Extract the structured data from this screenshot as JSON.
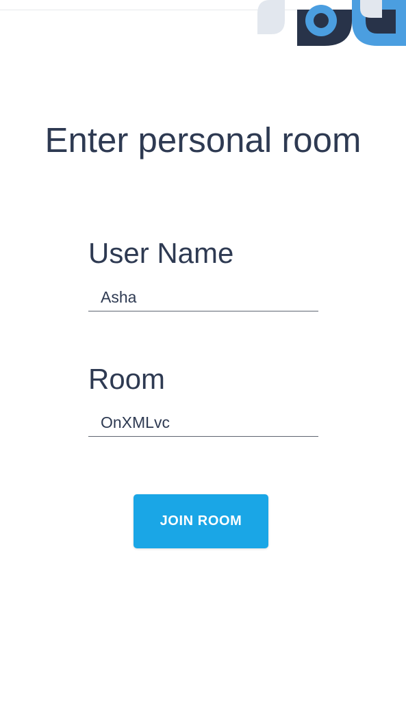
{
  "form": {
    "title": "Enter personal room",
    "user_name_label": "User Name",
    "user_name_value": "Asha",
    "room_label": "Room",
    "room_value": "OnXMLvc",
    "join_button_label": "JOIN ROOM"
  },
  "colors": {
    "text": "#2e3a52",
    "button_bg": "#1aa6e6",
    "logo_dark": "#283349",
    "logo_blue": "#4b9ee0",
    "logo_light": "#e2e7ee"
  },
  "icons": {
    "logo": "logo-graphic-icon"
  }
}
